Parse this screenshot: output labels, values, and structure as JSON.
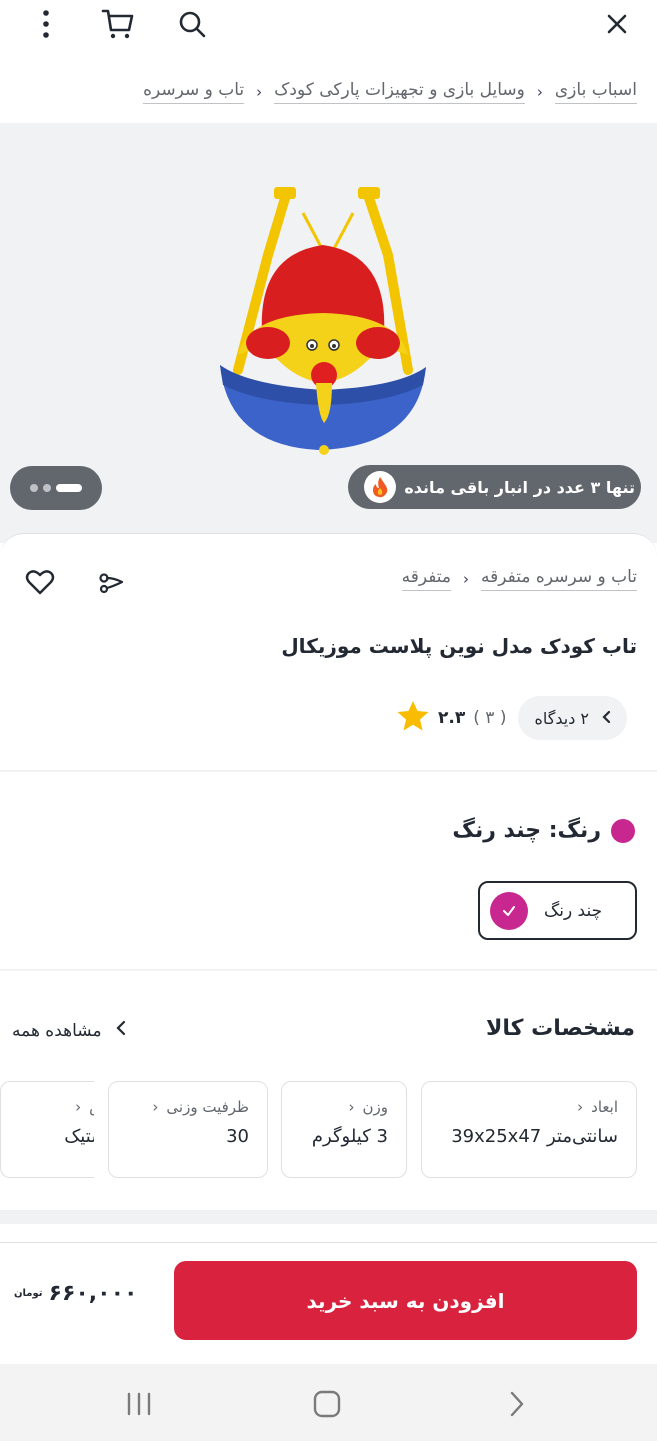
{
  "breadcrumb": {
    "items": [
      "اسباب بازی",
      "وسایل بازی و تجهیزات پارکی کودک",
      "تاب و سرسره"
    ]
  },
  "gallery": {
    "stock_text": "تنها ۳ عدد در انبار باقی مانده",
    "stock_icon": "fire-icon"
  },
  "product": {
    "category_path": [
      "متفرقه",
      "تاب و سرسره متفرقه"
    ],
    "title": "تاب کودک مدل نوین پلاست موزیکال",
    "rating": "۲.۳",
    "rating_count": "( ۳ )",
    "reviews_label": "۲ دیدگاه"
  },
  "color": {
    "label": "رنگ: چند رنگ",
    "selected_hex": "#c7278f",
    "option_label": "چند رنگ"
  },
  "specs": {
    "title": "مشخصات کالا",
    "see_all": "مشاهده همه",
    "items": [
      {
        "key": "ابعاد",
        "value": "سانتی‌متر 39x25x47"
      },
      {
        "key": "وزن",
        "value": "3 کیلوگرم"
      },
      {
        "key": "ظرفیت وزنی",
        "value": "30"
      },
      {
        "key": "جنس",
        "value": "پلاستیک"
      }
    ]
  },
  "buy": {
    "button_label": "افزودن به سبد خرید",
    "price": "۶۶۰,۰۰۰",
    "currency": "تومان",
    "accent": "#d9233e"
  }
}
